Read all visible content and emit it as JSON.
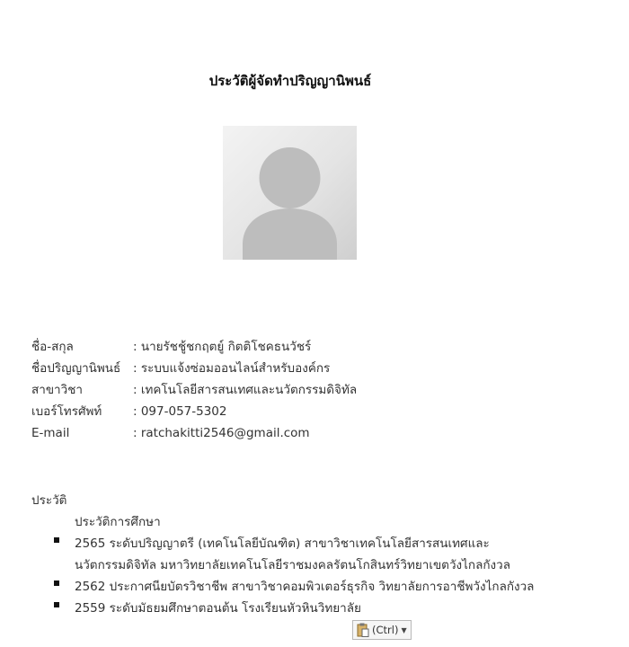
{
  "document": {
    "title": "ประวัติผู้จัดทำปริญญานิพนธ์"
  },
  "profile_photo": {
    "icon": "user-silhouette-placeholder"
  },
  "info": [
    {
      "label": "ชื่อ-สกุล",
      "value": ": นายรัชชู้ชกฤตยู์ กิตติโชคธนวัชร์"
    },
    {
      "label": "ชื่อปริญญานิพนธ์",
      "value": ": ระบบแจ้งซ่อมออนไลน์สำหรับองค์กร"
    },
    {
      "label": "สาขาวิชา",
      "value": ": เทคโนโลยีสารสนเทศและนวัตกรรมดิจิทัล"
    },
    {
      "label": "เบอร์โทรศัพท์",
      "value": ": 097-057-5302"
    },
    {
      "label": "E-mail",
      "value": ": ratchakitti2546@gmail.com"
    }
  ],
  "history": {
    "heading": "ประวัติ",
    "education_heading": "ประวัติการศึกษา",
    "education": [
      {
        "line1": "2565 ระดับปริญญาตรี (เทคโนโลยีบัณฑิต) สาขาวิชาเทคโนโลยีสารสนเทศและ",
        "line2": "นวัตกรรมดิจิทัล มหาวิทยาลัยเทคโนโลยีราชมงคลรัตนโกสินทร์วิทยาเขตวังไกลกังวล"
      },
      {
        "line1": "2562 ประกาศนียบัตรวิชาชีพ สาขาวิชาคอมพิวเตอร์ธุรกิจ วิทยาลัยการอาชีพวังไกลกังวล",
        "line2": ""
      },
      {
        "line1": "2559 ระดับมัธยมศึกษาตอนต้น โรงเรียนหัวหินวิทยาลัย",
        "line2": ""
      }
    ]
  },
  "paste_options": {
    "label": "(Ctrl)",
    "icon": "clipboard-paste-icon",
    "caret_icon": "dropdown-caret-icon"
  },
  "colors": {
    "bullet": "#111111",
    "text": "#333333"
  }
}
